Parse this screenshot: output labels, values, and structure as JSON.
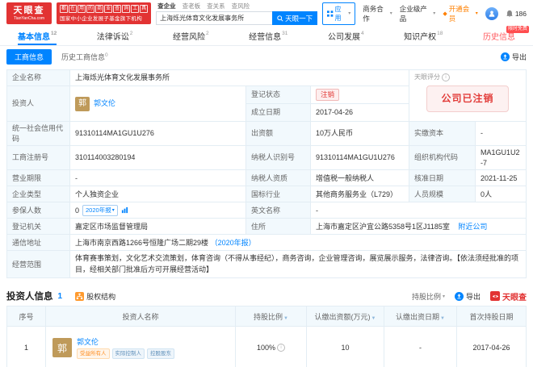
{
  "colors": {
    "brand_red": "#e23333",
    "accent_blue": "#0084ff",
    "vip_orange": "#ff8000",
    "status_red": "#e23c39"
  },
  "brand": {
    "logo_title": "天眼查",
    "logo_sub": "TianYanCha.com",
    "slogan_chars": [
      "都",
      "在",
      "用",
      "的",
      "商",
      "业",
      "查",
      "询",
      "工",
      "具"
    ],
    "slogan_line2": "国家中小企业发展子基金旗下机构"
  },
  "search": {
    "tabs": [
      "查企业",
      "查老板",
      "查关系",
      "查风险"
    ],
    "value": "上海烁光体育文化发展事务所",
    "button": "天眼一下"
  },
  "header_right": {
    "app": "应用",
    "biz": "商务合作",
    "enterprise": "企业级产品",
    "vip": "开通会员",
    "notice": "186"
  },
  "nav": {
    "tabs": [
      {
        "label": "基本信息",
        "count": "12"
      },
      {
        "label": "法律诉讼",
        "count": "2"
      },
      {
        "label": "经营风险",
        "count": "2"
      },
      {
        "label": "经营信息",
        "count": "31"
      },
      {
        "label": "公司发展",
        "count": "4"
      },
      {
        "label": "知识产权",
        "count": "18"
      },
      {
        "label": "历史信息",
        "count": "",
        "badge": "限时免费"
      }
    ]
  },
  "subnav": {
    "active": "工商信息",
    "history": "历史工商信息",
    "history_count": "0",
    "export": "导出"
  },
  "company": {
    "f_name": {
      "label": "企业名称",
      "value": "上海烁光体育文化发展事务所"
    },
    "score": {
      "label": "天眼评分",
      "status": "公司已注销"
    },
    "investor": {
      "label": "投资人",
      "avatar": "郭",
      "name": "郭文伦"
    },
    "reg_status": {
      "label": "登记状态",
      "value": "注销"
    },
    "est_date": {
      "label": "成立日期",
      "value": "2017-04-26"
    },
    "uscc": {
      "label": "统一社会信用代码",
      "value": "91310114MA1GU1U276"
    },
    "capital": {
      "label": "出资额",
      "value": "10万人民币"
    },
    "paid": {
      "label": "实缴资本",
      "value": "-"
    },
    "regno": {
      "label": "工商注册号",
      "value": "310114003280194"
    },
    "taxid": {
      "label": "纳税人识别号",
      "value": "91310114MA1GU1U276"
    },
    "orgcode": {
      "label": "组织机构代码",
      "value": "MA1GU1U2-7"
    },
    "term": {
      "label": "营业期限",
      "value": "-"
    },
    "taxpayer": {
      "label": "纳税人资质",
      "value": "增值税一般纳税人"
    },
    "approval": {
      "label": "核准日期",
      "value": "2021-11-25"
    },
    "type": {
      "label": "企业类型",
      "value": "个人独资企业"
    },
    "industry": {
      "label": "国标行业",
      "value": "其他商务服务业（L729）"
    },
    "staff": {
      "label": "人员规模",
      "value": "0人"
    },
    "insured": {
      "label": "参保人数",
      "value": "0",
      "tag": "2020年报"
    },
    "en": {
      "label": "英文名称",
      "value": "-"
    },
    "authority": {
      "label": "登记机关",
      "value": "嘉定区市场监督管理局"
    },
    "address": {
      "label": "住所",
      "value": "上海市嘉定区沪宜公路5358号1区J1185室",
      "nearby": "附近公司"
    },
    "mail": {
      "label": "通信地址",
      "value": "上海市南京西路1266号恒隆广场二期29楼",
      "note": "（2020年报）"
    },
    "scope": {
      "label": "经营范围",
      "value": "体育赛事策划，文化艺术交流策划，体育咨询（不得从事经纪），商务咨询，企业管理咨询，展览展示服务，法律咨询。【依法须经批准的项目，经相关部门批准后方可开展经营活动】"
    }
  },
  "investors": {
    "title": "投资人信息",
    "count": "1",
    "equity": "股权结构",
    "filter": "持股比例",
    "export": "导出",
    "brand": "天眼查",
    "headers": [
      "序号",
      "投资人名称",
      "持股比例",
      "认缴出资额(万元)",
      "认缴出资日期",
      "首次持股日期"
    ],
    "row": {
      "no": "1",
      "avatar": "郭",
      "name": "郭文伦",
      "tags": [
        "受益所有人",
        "实际控制人",
        "控股股东"
      ],
      "ratio": "100%",
      "amount": "10",
      "date": "-",
      "first": "2017-04-26"
    }
  }
}
